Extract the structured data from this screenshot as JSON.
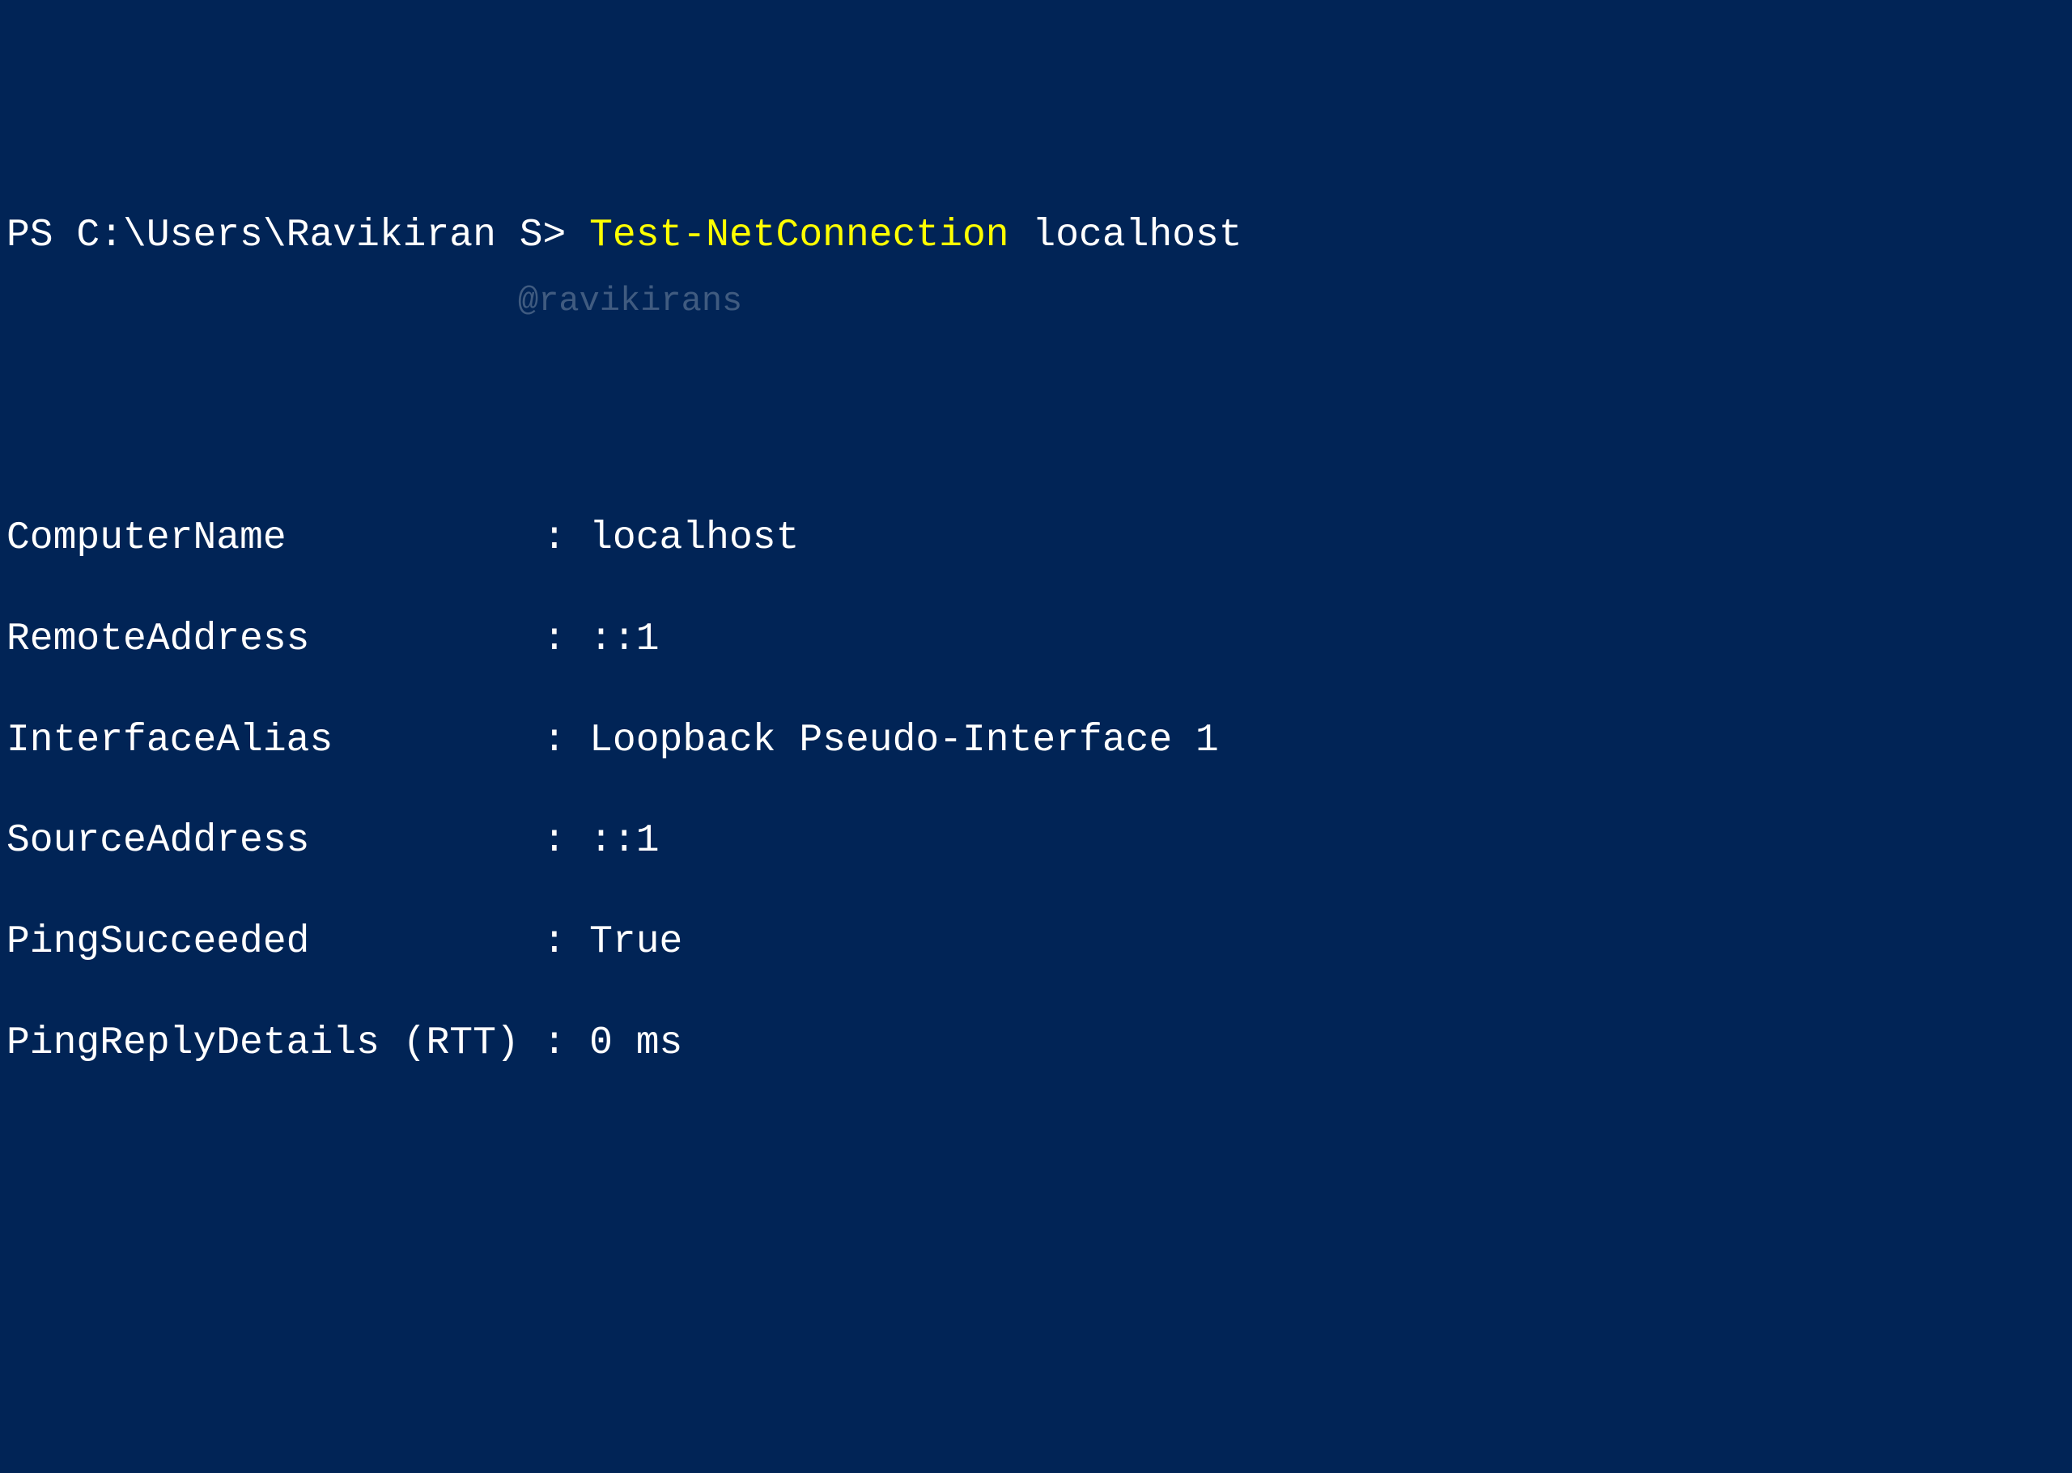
{
  "prompt": {
    "prefix": "PS C:\\Users\\Ravikiran S> ",
    "command": "Test-NetConnection",
    "argument": " localhost"
  },
  "output": {
    "rows": [
      {
        "key": "ComputerName          ",
        "sep": " : ",
        "value": "localhost"
      },
      {
        "key": "RemoteAddress         ",
        "sep": " : ",
        "value": "::1"
      },
      {
        "key": "InterfaceAlias        ",
        "sep": " : ",
        "value": "Loopback Pseudo-Interface 1"
      },
      {
        "key": "SourceAddress         ",
        "sep": " : ",
        "value": "::1"
      },
      {
        "key": "PingSucceeded         ",
        "sep": " : ",
        "value": "True"
      },
      {
        "key": "PingReplyDetails (RTT)",
        "sep": " : ",
        "value": "0 ms"
      }
    ]
  },
  "watermark": "@ravikirans"
}
